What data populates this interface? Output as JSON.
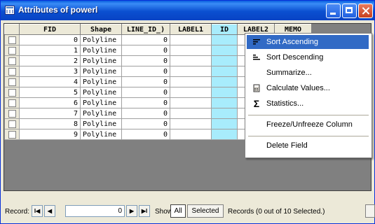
{
  "window": {
    "title": "Attributes of powerl"
  },
  "table": {
    "columns": [
      "FID",
      "Shape",
      "LINE_ID_1",
      "LABEL1",
      "ID",
      "LABEL2",
      "MEMO"
    ],
    "column_display": [
      "FID",
      "Shape",
      "LINE_ID_)",
      "LABEL1",
      "ID",
      "LABEL2",
      "MEMO"
    ],
    "rows": [
      {
        "fid": "0",
        "shape": "Polyline",
        "line_id": "0"
      },
      {
        "fid": "1",
        "shape": "Polyline",
        "line_id": "0"
      },
      {
        "fid": "2",
        "shape": "Polyline",
        "line_id": "0"
      },
      {
        "fid": "3",
        "shape": "Polyline",
        "line_id": "0"
      },
      {
        "fid": "4",
        "shape": "Polyline",
        "line_id": "0"
      },
      {
        "fid": "5",
        "shape": "Polyline",
        "line_id": "0"
      },
      {
        "fid": "6",
        "shape": "Polyline",
        "line_id": "0"
      },
      {
        "fid": "7",
        "shape": "Polyline",
        "line_id": "0"
      },
      {
        "fid": "8",
        "shape": "Polyline",
        "line_id": "0"
      },
      {
        "fid": "9",
        "shape": "Polyline",
        "line_id": "0"
      }
    ]
  },
  "context_menu": {
    "items": [
      {
        "label": "Sort Ascending",
        "icon": "sort-ascending-icon",
        "active": true
      },
      {
        "label": "Sort Descending",
        "icon": "sort-descending-icon"
      },
      {
        "label": "Summarize...",
        "icon": ""
      },
      {
        "label": "Calculate Values...",
        "icon": "calculator-icon"
      },
      {
        "label": "Statistics...",
        "icon": "sigma-icon"
      },
      {
        "label": "Freeze/Unfreeze Column",
        "icon": ""
      },
      {
        "label": "Delete Field",
        "icon": ""
      }
    ]
  },
  "status": {
    "record_label": "Record:",
    "record_value": "0",
    "show_label": "Show:",
    "all_label": "All",
    "selected_label": "Selected",
    "records_text": "Records (0 out of 10 Selected.)",
    "first_glyph": "I◀",
    "prev_glyph": "◀",
    "next_glyph": "▶",
    "last_glyph": "▶I"
  },
  "colors": {
    "titlebar": "#0a4fd0",
    "highlight_column": "#a8ecfc",
    "menu_active": "#316ac5"
  }
}
